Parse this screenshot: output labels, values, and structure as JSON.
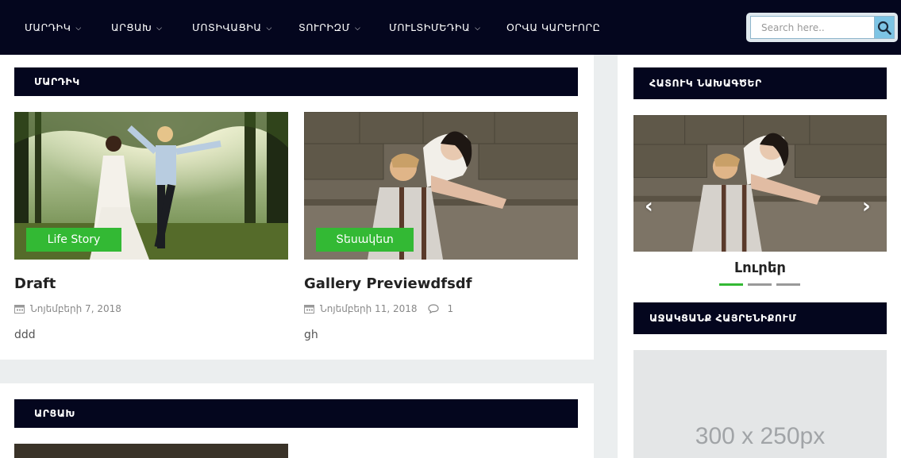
{
  "nav": {
    "items": [
      {
        "label": "ՄԱՐԴԻԿ",
        "has_dropdown": true
      },
      {
        "label": "ԱՐՑԱԽ",
        "has_dropdown": true
      },
      {
        "label": "ՄՈՏԻՎԱՑԻԱ",
        "has_dropdown": true
      },
      {
        "label": "ՏՈՒՐԻԶՄ",
        "has_dropdown": true
      },
      {
        "label": "ՄՈՒԼՏԻՄԵԴԻԱ",
        "has_dropdown": true
      },
      {
        "label": "ՕՐՎԱ ԿԱՐԵՒՈՐԸ",
        "has_dropdown": false
      }
    ],
    "chevron": "chevron-down-icon"
  },
  "search": {
    "placeholder": "Search here..",
    "icon": "search-icon"
  },
  "sections": {
    "people": {
      "title": "ՄԱՐԴԻԿ",
      "posts": [
        {
          "badge": "Life Story",
          "title": "Draft",
          "date": "Նոյեմբերի 7, 2018",
          "comments": "",
          "excerpt": "ddd"
        },
        {
          "badge": "Տեսակետ",
          "title": "Gallery Previewdfsdf",
          "date": "Նոյեմբերի 11, 2018",
          "comments": "1",
          "excerpt": "gh"
        }
      ]
    },
    "artsakh": {
      "title": "ԱՐՑԱԽ"
    }
  },
  "sidebar": {
    "featured": {
      "title": "ՀԱՏՈՒԿ ՆԱԽԱԳԾԵՐ",
      "slide_caption": "Լուրեր",
      "dots": 3,
      "active_dot": 0
    },
    "support": {
      "title": "ԱՋԱԿՑԱՆՔ ՀԱՅՐԵՆԻՔՈՒՄ"
    },
    "ad": {
      "label": "300 x 250px"
    }
  },
  "colors": {
    "nav_bg": "#04061e",
    "accent_green": "#33b934",
    "page_bg": "#ebeeef"
  }
}
